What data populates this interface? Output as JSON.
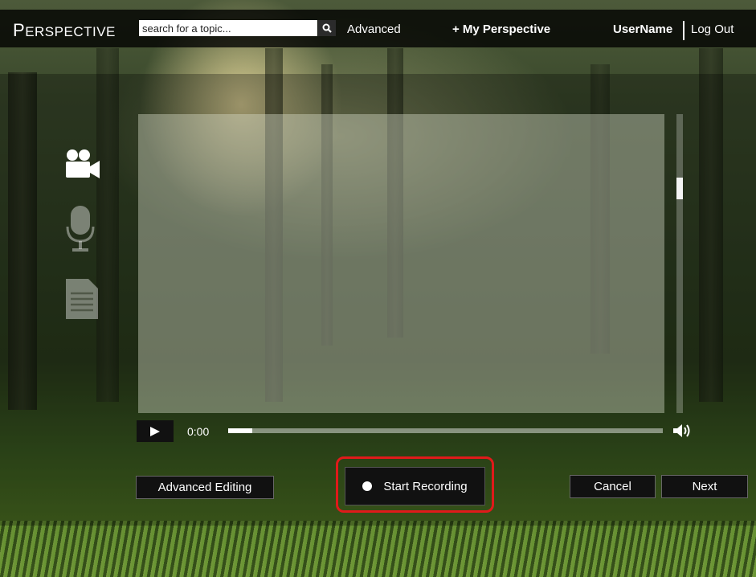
{
  "header": {
    "logo_first": "P",
    "logo_rest": "ERSPECTIVE",
    "search_placeholder": "search for a topic...",
    "advanced_label": "Advanced",
    "my_perspective_label": "+ My Perspective",
    "username": "UserName",
    "logout_label": "Log Out"
  },
  "sidebar": {
    "items": [
      {
        "icon": "video-camera-icon"
      },
      {
        "icon": "microphone-icon"
      },
      {
        "icon": "document-icon"
      }
    ]
  },
  "player": {
    "time": "0:00",
    "progress": 0.055
  },
  "actions": {
    "advanced_editing_label": "Advanced Editing",
    "start_recording_label": "Start Recording",
    "cancel_label": "Cancel",
    "next_label": "Next"
  },
  "colors": {
    "highlight": "#e01a1a"
  }
}
